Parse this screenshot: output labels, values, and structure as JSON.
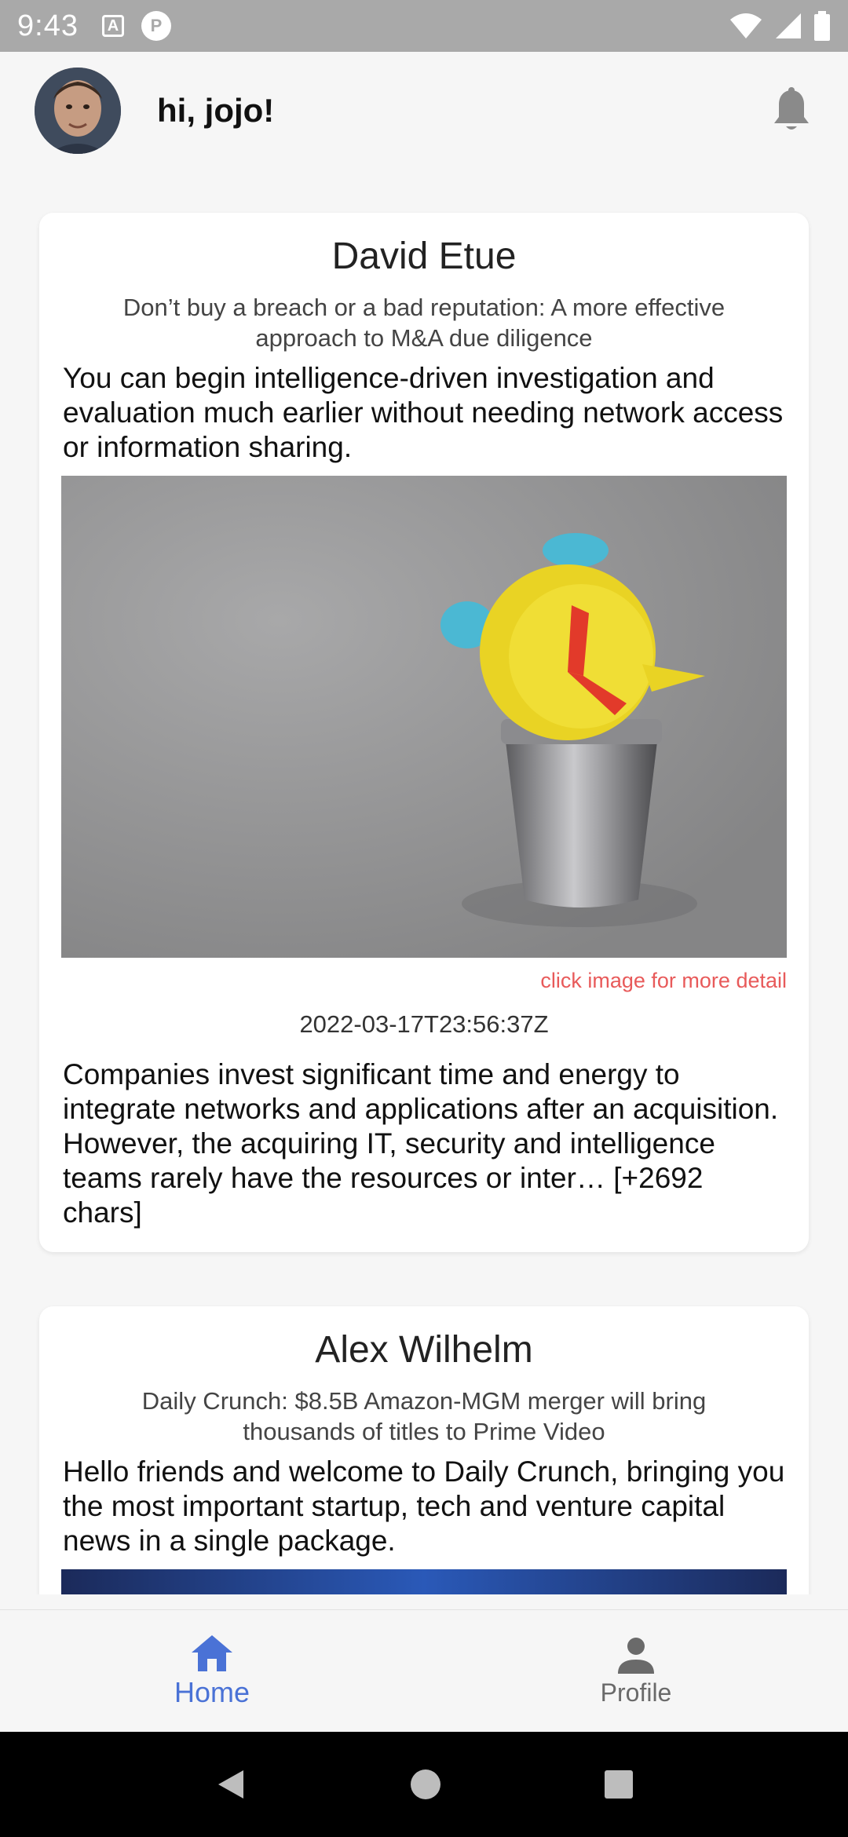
{
  "status_bar": {
    "time": "9:43",
    "icons": [
      "text-a-icon",
      "p-circle-icon",
      "wifi-icon",
      "signal-icon",
      "battery-icon"
    ]
  },
  "header": {
    "greeting": "hi, jojo!",
    "avatar_icon": "avatar",
    "notification_icon": "bell-icon"
  },
  "feed": {
    "articles": [
      {
        "author": "David Etue",
        "title": "Don’t buy a breach or a bad reputation: A more effective approach to M&A due diligence",
        "description": "You can begin intelligence-driven investigation and evaluation much earlier without needing network access or information sharing.",
        "image_hint": "click image for more detail",
        "published_at": "2022-03-17T23:56:37Z",
        "content": "Companies invest significant time and energy to integrate networks and applications after an acquisition. However, the acquiring IT, security and intelligence teams rarely have the resources or inter… [+2692 chars]"
      },
      {
        "author": "Alex Wilhelm",
        "title": "Daily Crunch: $8.5B Amazon-MGM merger will bring thousands of titles to Prime Video",
        "description": "Hello friends and welcome to Daily Crunch, bringing you the most important startup, tech and venture capital news in a single package."
      }
    ]
  },
  "bottom_nav": {
    "items": [
      {
        "label": "Home",
        "icon": "home-icon",
        "active": true
      },
      {
        "label": "Profile",
        "icon": "person-icon",
        "active": false
      }
    ]
  },
  "system_nav": {
    "icons": [
      "back-icon",
      "home-circle-icon",
      "recents-icon"
    ]
  },
  "colors": {
    "accent": "#4a72d6",
    "hint": "#e85a5a",
    "status_bar": "#a9a9a9"
  }
}
